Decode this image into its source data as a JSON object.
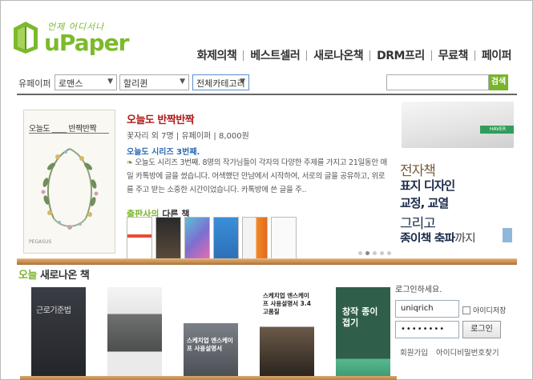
{
  "header": {
    "logo_slogan": "언제 어디서나",
    "logo_text": "uPaper",
    "nav": [
      {
        "label": "화제의책"
      },
      {
        "label": "베스트셀러"
      },
      {
        "label": "새로나온책"
      },
      {
        "label": "DRM프리"
      },
      {
        "label": "무료책"
      },
      {
        "label": "페이퍼"
      }
    ]
  },
  "search_bar": {
    "breadcrumb": "유페이퍼 >",
    "category1": "로맨스",
    "category2": "할리퀸",
    "category3": "전체카테고리",
    "search_value": "",
    "search_button": "검색"
  },
  "featured": {
    "cover_title": "오늘도 ____ 반짝반짝",
    "cover_publisher": "PEGASUS",
    "title": "오늘도 반짝반짝",
    "meta": "꽃자리 외 7명 | 유페이퍼 | 8,000원",
    "series": "오늘도 시리즈 3번째.",
    "description": "오늘도 시리즈 3번째. 8명의 작가님들이 각자의 다양한 주제를 가지고 21일동안 매일 카톡방에 글을 썼습니다. 어색했던 만남에서 시작하여, 서로의 글을 공유하고, 위로를 주고 받는 소중한 시간이었습니다. 카톡방에 쓴 글을 주..",
    "publisher_books_title_pub": "출판사의",
    "publisher_books_title_rest": " 다른 책"
  },
  "ad": {
    "book_strip": "HAVER",
    "line1": "전자책",
    "line2": "표지 디자인",
    "line3": "교정, 교열",
    "line4": "그리고",
    "line5_bold": "종이책 축파",
    "line5_thin": "까지"
  },
  "carousel": {
    "count": 5,
    "active": 2
  },
  "new_books": {
    "title_today": "오늘",
    "title_rest": " 새로나온 책",
    "books": [
      {
        "title": "근로기준법"
      },
      {
        "title": ""
      },
      {
        "title": "스케치업 엔스케이프 사용설명서"
      },
      {
        "title": "스케치업 엔스케이프 사용설명서 3.4 고품질"
      },
      {
        "title": "창작 종이접기"
      }
    ]
  },
  "login": {
    "title": "로그인하세요.",
    "username": "uniqrich",
    "password_mask": "••••••••",
    "save_id_label": "아이디저장",
    "login_button": "로그인",
    "signup_link": "회원가입",
    "find_link": "아이디비밀번호찾기"
  },
  "colors": {
    "brand_green": "#7ab42a",
    "title_red": "#b01818",
    "link_blue": "#2a6bb5"
  }
}
